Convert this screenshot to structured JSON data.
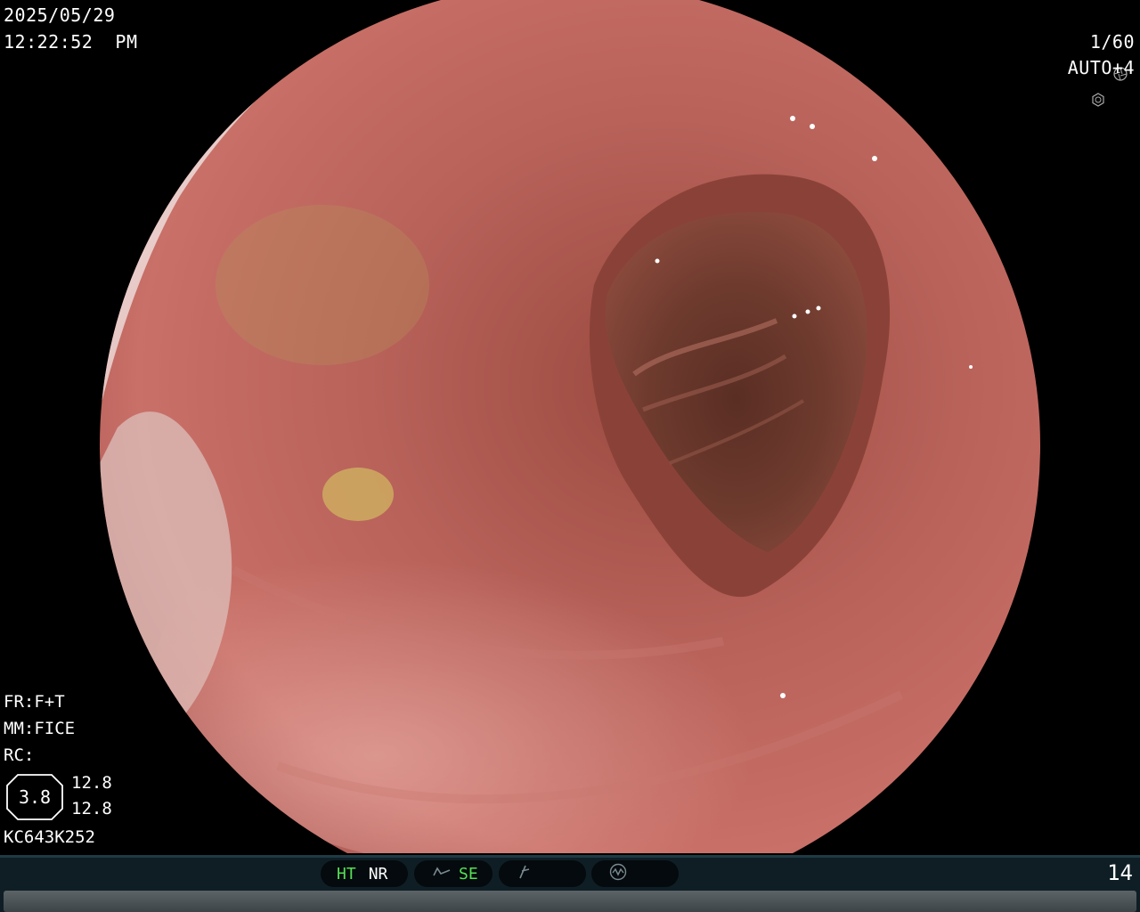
{
  "overlay": {
    "date": "2025/05/29",
    "time": "12:22:52  PM",
    "shutter": "1/60",
    "iris": "AUTO+4",
    "icons": [
      "shutter-icon",
      "iris-icon",
      "wave-icon"
    ],
    "settings": [
      "FR:F+T",
      "MM:FICE",
      "RC:"
    ],
    "ratio_badge": "3.8",
    "ratio_values": [
      "12.8",
      "12.8"
    ],
    "serial": "KC643K252"
  },
  "status_bar": {
    "ht": "HT",
    "nr": "NR",
    "se": "SE",
    "page": "14"
  },
  "colors": {
    "mucosa": "#b5605a",
    "lumen": "#3a1a14",
    "status_green": "#55e055",
    "background": "#000000"
  }
}
